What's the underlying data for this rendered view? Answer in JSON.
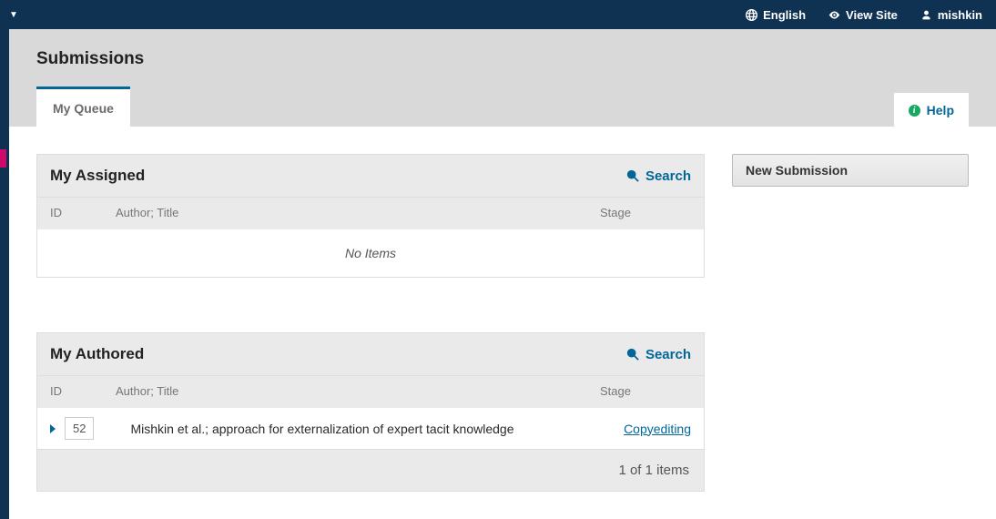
{
  "topbar": {
    "language": "English",
    "view_site": "View Site",
    "username": "mishkin"
  },
  "page": {
    "title": "Submissions"
  },
  "tabs": {
    "active": "My Queue"
  },
  "help": {
    "label": "Help"
  },
  "sidebar_button": {
    "new_submission": "New Submission"
  },
  "assigned_panel": {
    "title": "My Assigned",
    "search": "Search",
    "col_id": "ID",
    "col_author": "Author; Title",
    "col_stage": "Stage",
    "empty": "No Items"
  },
  "authored_panel": {
    "title": "My Authored",
    "search": "Search",
    "col_id": "ID",
    "col_author": "Author; Title",
    "col_stage": "Stage",
    "rows": [
      {
        "id": "52",
        "title": "Mishkin et al.; approach for externalization of expert tacit knowledge",
        "stage": "Copyediting"
      }
    ],
    "footer": "1 of 1 items"
  }
}
